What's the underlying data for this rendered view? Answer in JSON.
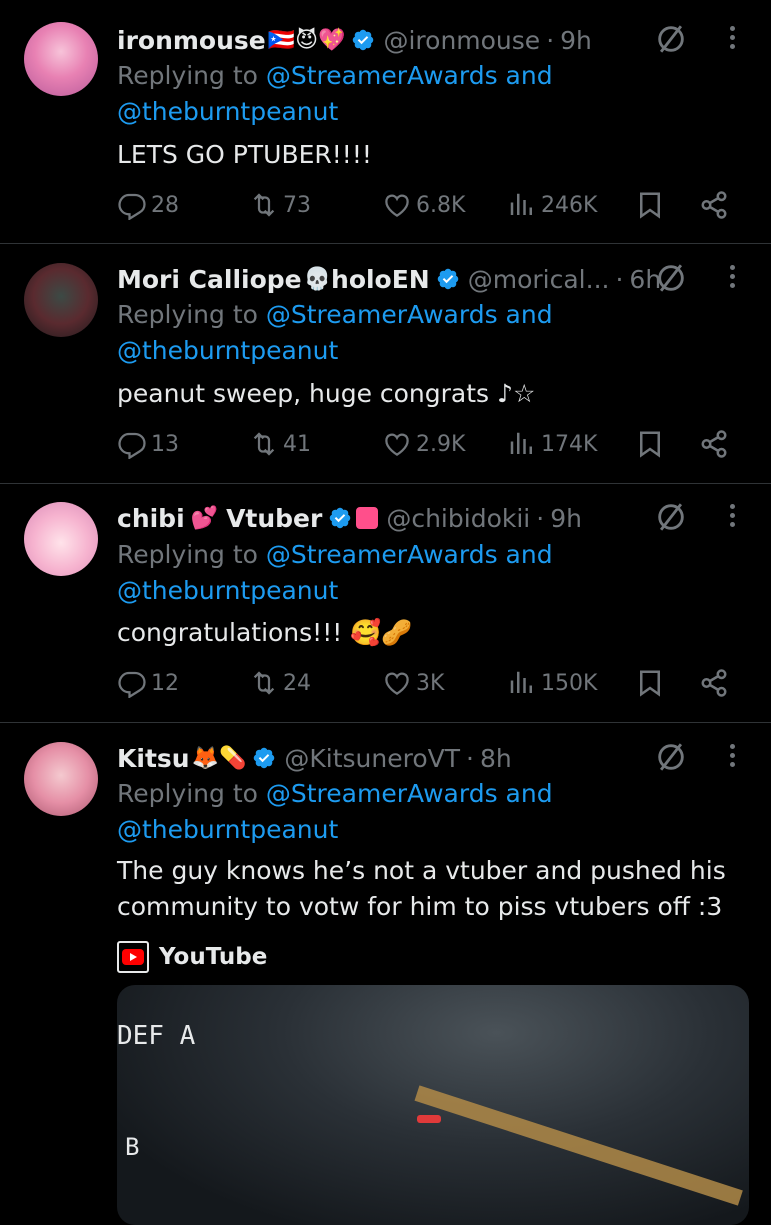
{
  "tweets": [
    {
      "name": "ironmouse",
      "name_emojis": "🇵🇷😈💖",
      "handle": "@ironmouse",
      "time": "9h",
      "replying_prefix": "Replying to ",
      "mention1": "@StreamerAwards",
      "and": " and",
      "mention2": "@theburntpeanut",
      "text": "LETS GO PTUBER!!!!",
      "replies": "28",
      "reposts": "73",
      "likes": "6.8K",
      "views": "246K"
    },
    {
      "name": "Mori Calliope",
      "name_emojis": "💀",
      "name_suffix": "holoEN",
      "handle": "@morical...",
      "time": "6h",
      "replying_prefix": "Replying to ",
      "mention1": "@StreamerAwards",
      "and": " and",
      "mention2": "@theburntpeanut",
      "text": "peanut sweep, huge congrats ♪☆",
      "replies": "13",
      "reposts": "41",
      "likes": "2.9K",
      "views": "174K"
    },
    {
      "name": "chibi",
      "name_emojis": "💕",
      "name_suffix": "Vtuber",
      "handle": "@chibidokii",
      "time": "9h",
      "replying_prefix": "Replying to ",
      "mention1": "@StreamerAwards",
      "and": " and",
      "mention2": "@theburntpeanut",
      "text": "congratulations!!! 🥰🥜",
      "replies": "12",
      "reposts": "24",
      "likes": "3K",
      "views": "150K"
    },
    {
      "name": "Kitsu",
      "name_emojis": "🦊💊",
      "handle": "@KitsuneroVT",
      "time": "8h",
      "replying_prefix": "Replying to ",
      "mention1": "@StreamerAwards",
      "and": " and",
      "mention2": "@theburntpeanut",
      "text": "The guy knows he’s not a vtuber and pushed his community to votw for him to piss vtubers off :3",
      "card_source": "YouTube",
      "media_overlay": [
        "DEF A",
        "B"
      ]
    }
  ],
  "colors": {
    "background": "#000000",
    "text": "#e7e9ea",
    "muted": "#71767b",
    "link": "#1d9bf0",
    "verified": "#1d9bf0",
    "divider": "#2f3336"
  },
  "icons": [
    "reply-icon",
    "repost-icon",
    "like-icon",
    "views-icon",
    "bookmark-icon",
    "share-icon",
    "grok-icon",
    "more-icon",
    "verified-icon"
  ]
}
